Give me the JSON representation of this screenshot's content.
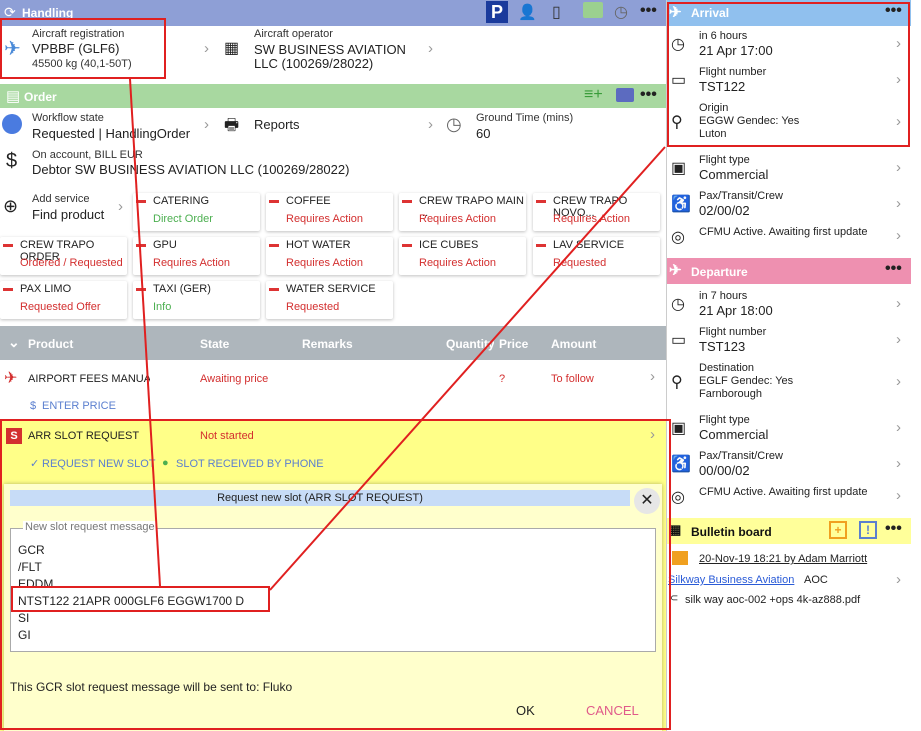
{
  "handling": {
    "title": "Handling"
  },
  "aircraft": {
    "reg_label": "Aircraft registration",
    "reg_value": "VPBBF (GLF6)",
    "weight": "45500 kg (40,1-50T)",
    "operator_label": "Aircraft operator",
    "operator_line1": "SW BUSINESS AVIATION",
    "operator_line2": "LLC (100269/28022)"
  },
  "order": {
    "title": "Order",
    "workflow_label": "Workflow state",
    "workflow_value": "Requested | HandlingOrder",
    "reports": "Reports",
    "ground_label": "Ground Time (mins)",
    "ground_value": "60",
    "account_label": "On account, BILL EUR",
    "account_value": "Debtor SW BUSINESS AVIATION LLC (100269/28022)",
    "add_label": "Add service",
    "add_value": "Find product"
  },
  "services": [
    {
      "name": "CATERING",
      "status": "Direct Order",
      "color": "#4caf50"
    },
    {
      "name": "COFFEE",
      "status": "Requires Action",
      "color": "#d32f2f"
    },
    {
      "name": "CREW TRAPO MAIN ...",
      "status": "Requires Action",
      "color": "#d32f2f"
    },
    {
      "name": "CREW TRAPO NOVO...",
      "status": "Requires Action",
      "color": "#d32f2f"
    },
    {
      "name": "CREW TRAPO ORDER",
      "status": "Ordered / Requested",
      "color": "#d32f2f"
    },
    {
      "name": "GPU",
      "status": "Requires Action",
      "color": "#d32f2f"
    },
    {
      "name": "HOT WATER",
      "status": "Requires Action",
      "color": "#d32f2f"
    },
    {
      "name": "ICE CUBES",
      "status": "Requires Action",
      "color": "#d32f2f"
    },
    {
      "name": "LAV SERVICE",
      "status": "Requested",
      "color": "#d32f2f"
    },
    {
      "name": "PAX LIMO",
      "status": "Requested Offer",
      "color": "#d32f2f"
    },
    {
      "name": "TAXI (GER)",
      "status": "Info",
      "color": "#4caf50"
    },
    {
      "name": "WATER SERVICE",
      "status": "Requested",
      "color": "#d32f2f"
    }
  ],
  "table": {
    "headers": [
      "Product",
      "State",
      "Remarks",
      "Quantity",
      "Price",
      "Amount"
    ],
    "row1": {
      "product": "AIRPORT FEES MANUAL",
      "state": "Awaiting price",
      "price": "?",
      "amount": "To follow",
      "action": "ENTER PRICE"
    },
    "row2": {
      "product": "ARR SLOT REQUEST",
      "state": "Not started",
      "action1": "REQUEST NEW SLOT",
      "action2": "SLOT RECEIVED BY PHONE"
    }
  },
  "dialog": {
    "title": "Request new slot (ARR SLOT REQUEST)",
    "legend": "New slot request message",
    "lines": [
      "GCR",
      "/FLT",
      "EDDM",
      "NTST122 21APR 000GLF6 EGGW1700 D",
      "SI",
      "GI"
    ],
    "note": "This GCR slot request message will be sent to: Fluko",
    "ok": "OK",
    "cancel": "CANCEL"
  },
  "arrival": {
    "title": "Arrival",
    "time_rel": "in 6 hours",
    "time": "21 Apr 17:00",
    "flight_label": "Flight number",
    "flight": "TST122",
    "origin_label": "Origin",
    "origin": "EGGW Gendec: Yes",
    "origin_city": "Luton",
    "type_label": "Flight type",
    "type": "Commercial",
    "pax_label": "Pax/Transit/Crew",
    "pax": "02/00/02",
    "cfmu": "CFMU Active. Awaiting first update"
  },
  "departure": {
    "title": "Departure",
    "time_rel": "in 7 hours",
    "time": "21 Apr 18:00",
    "flight_label": "Flight number",
    "flight": "TST123",
    "dest_label": "Destination",
    "dest": "EGLF Gendec: Yes",
    "dest_city": "Farnborough",
    "type_label": "Flight type",
    "type": "Commercial",
    "pax_label": "Pax/Transit/Crew",
    "pax": "00/00/02",
    "cfmu": "CFMU Active. Awaiting first update"
  },
  "bulletin": {
    "title": "Bulletin board",
    "entry": "20-Nov-19 18:21 by Adam Marriott",
    "company": "Silkway Business Aviation",
    "company_tag": "AOC",
    "file": "silk way aoc-002 +ops 4k-az888.pdf"
  }
}
